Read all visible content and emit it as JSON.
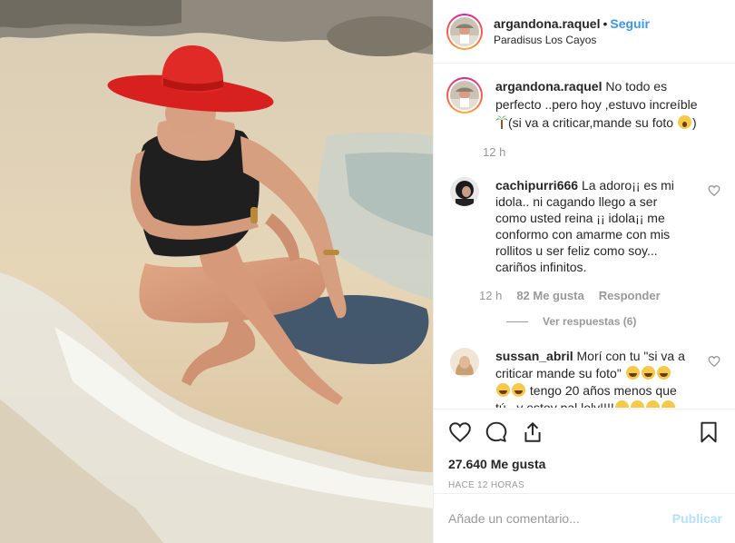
{
  "post": {
    "username": "argandona.raquel",
    "separator": "•",
    "follow_label": "Seguir",
    "location": "Paradisus Los Cayos"
  },
  "caption": {
    "username": "argandona.raquel",
    "text_before_palm": "No todo es perfecto ..pero hoy ,estuvo increíble",
    "text_after_palm": "(si va a criticar,mande su foto",
    "text_end": ")",
    "time": "12 h"
  },
  "comments": [
    {
      "username": "cachipurri666",
      "text": "La adoro¡¡ es mi idola.. ni cagando llego a ser como usted reina ¡¡ idola¡¡ me conformo con amarme con mis rollitos u ser feliz como soy... cariños infinitos.",
      "time": "12 h",
      "likes": "82 Me gusta",
      "reply_label": "Responder",
      "view_replies": "Ver respuestas (6)"
    },
    {
      "username": "sussan_abril",
      "text_a": "Morí con tu \"si va a criticar mande su foto\"",
      "text_b": "tengo 20 años menos que tú.. y estoy pal loly!!!!"
    }
  ],
  "actions": {
    "likes": "27.640 Me gusta",
    "time_ago": "HACE 12 HORAS",
    "icons": [
      "heart-icon",
      "comment-icon",
      "share-icon",
      "bookmark-icon"
    ]
  },
  "add_comment": {
    "placeholder": "Añade un comentario...",
    "publish_label": "Publicar"
  },
  "colors": {
    "link_blue": "#3897f0",
    "publish_disabled": "#b2dffc",
    "muted": "#999999",
    "text": "#262626"
  }
}
